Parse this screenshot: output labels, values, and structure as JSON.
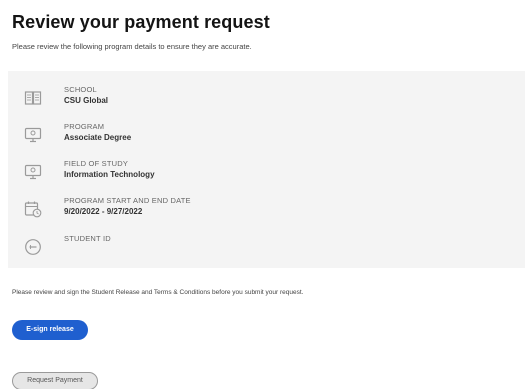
{
  "header": {
    "title": "Review your payment request",
    "subtitle": "Please review the following program details to ensure they are accurate."
  },
  "details": [
    {
      "label": "SCHOOL",
      "value": "CSU Global",
      "icon": "book-icon"
    },
    {
      "label": "PROGRAM",
      "value": "Associate Degree",
      "icon": "monitor-icon"
    },
    {
      "label": "FIELD OF STUDY",
      "value": "Information Technology",
      "icon": "monitor-icon"
    },
    {
      "label": "PROGRAM START AND END DATE",
      "value": "9/20/2022 - 9/27/2022",
      "icon": "calendar-clock-icon"
    },
    {
      "label": "STUDENT ID",
      "value": "",
      "icon": "id-badge-icon"
    }
  ],
  "notice": "Please review and sign the Student Release and Terms & Conditions before you submit your request.",
  "actions": {
    "esign_label": "E-sign release",
    "request_label": "Request Payment"
  },
  "colors": {
    "primary_button": "#1f5fcf",
    "panel_background": "#f4f4f4",
    "disabled_button": "#e6e6e6"
  }
}
